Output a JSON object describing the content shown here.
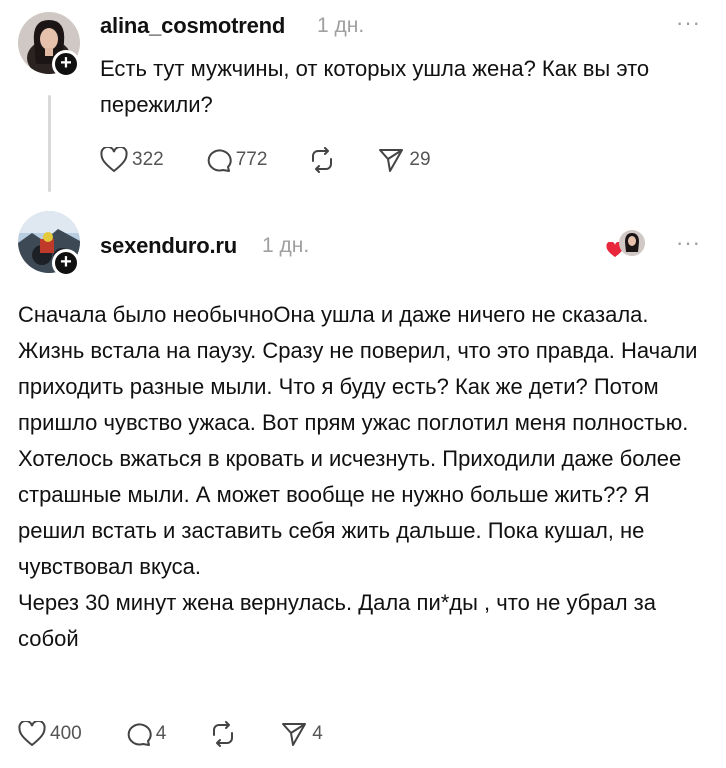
{
  "posts": [
    {
      "username": "alina_cosmotrend",
      "time": "1 дн.",
      "more": "···",
      "text": "Есть тут мужчины, от которых ушла жена? Как вы это пережили?",
      "likes": "322",
      "comments": "772",
      "shares": "29"
    },
    {
      "username": "sexenduro.ru",
      "time": "1 дн.",
      "more": "···",
      "paragraphs": [
        "Сначала было необычноОна ушла и даже ничего не сказала. Жизнь встала на паузу. Сразу не поверил, что это правда. Начали приходить разные мыли. Что я буду есть? Как же дети? Потом пришло чувство ужаса. Вот прям ужас поглотил меня полностью. Хотелось вжаться в кровать и исчезнуть. Приходили даже более страшные мыли. А может вообще не нужно больше жить?? Я решил встать и заставить себя жить дальше. Пока кушал, не чувствовал вкуса.",
        "Через 30 минут жена вернулась. Дала пи*ды , что не убрал за собой"
      ],
      "likes": "400",
      "comments": "4",
      "shares": "4"
    }
  ],
  "icons": {
    "follow": "+",
    "heart": "heart-icon",
    "comment": "comment-icon",
    "repost": "repost-icon",
    "share": "share-icon",
    "liked_by_author": "red-heart-icon"
  },
  "colors": {
    "liked_heart": "#e8263c",
    "muted": "#a0a0a0"
  }
}
